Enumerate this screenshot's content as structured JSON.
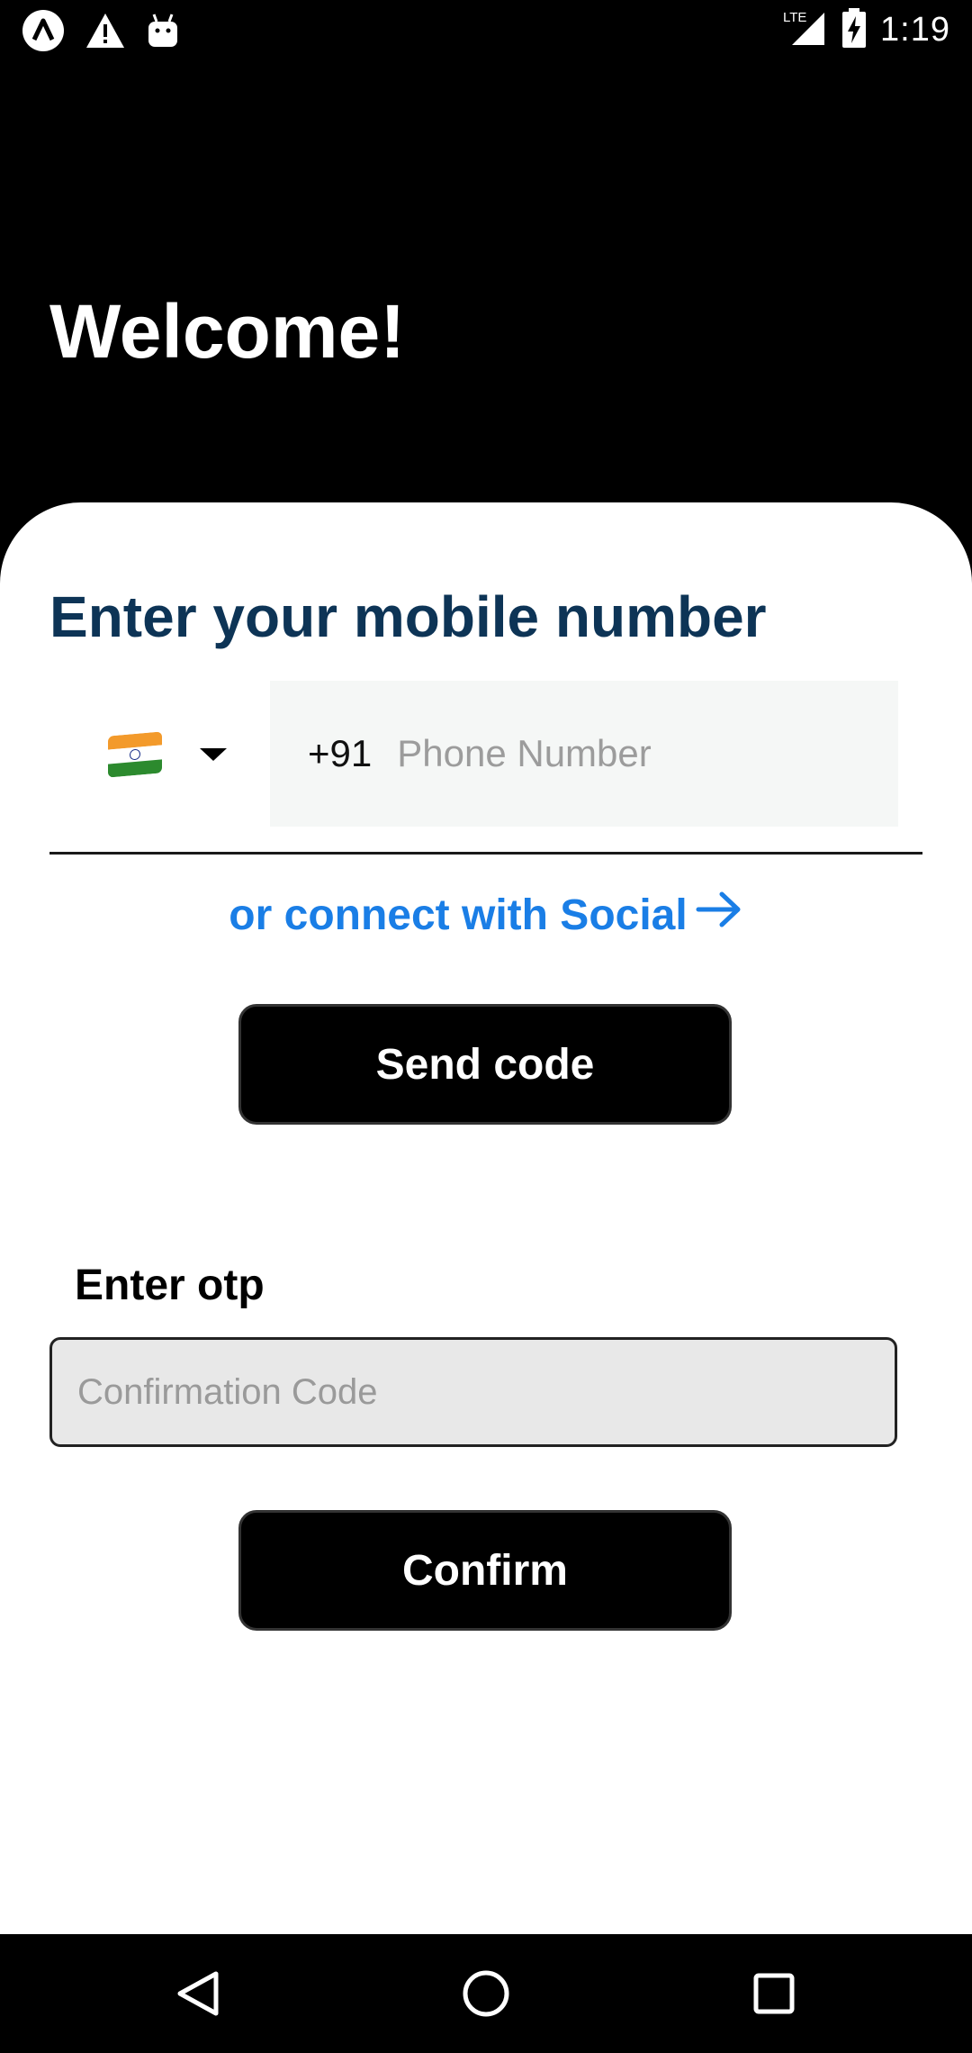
{
  "status_bar": {
    "time": "1:19",
    "network": "LTE",
    "left_icons": [
      "app-notification-icon",
      "warning-icon",
      "android-debug-icon"
    ],
    "right_icons": [
      "signal-icon",
      "battery-charging-icon"
    ]
  },
  "header": {
    "title": "Welcome!"
  },
  "phone_form": {
    "title": "Enter your mobile number",
    "country_flag_icon": "india-flag-icon",
    "dial_code": "+91",
    "phone_placeholder": "Phone Number",
    "phone_value": "",
    "social_link_label": "or connect with Social",
    "social_link_icon": "arrow-right-icon",
    "send_button_label": "Send code"
  },
  "otp_form": {
    "label": "Enter otp",
    "placeholder": "Confirmation Code",
    "value": "",
    "confirm_button_label": "Confirm"
  },
  "nav_bar": {
    "items": [
      "back-icon",
      "home-icon",
      "recents-icon"
    ]
  },
  "colors": {
    "background": "#000000",
    "sheet": "#ffffff",
    "title": "#0d3456",
    "link": "#1a7ee6",
    "button": "#000000",
    "otp_input_bg": "#e8e8e8",
    "phone_input_bg": "#f5f7f6"
  }
}
